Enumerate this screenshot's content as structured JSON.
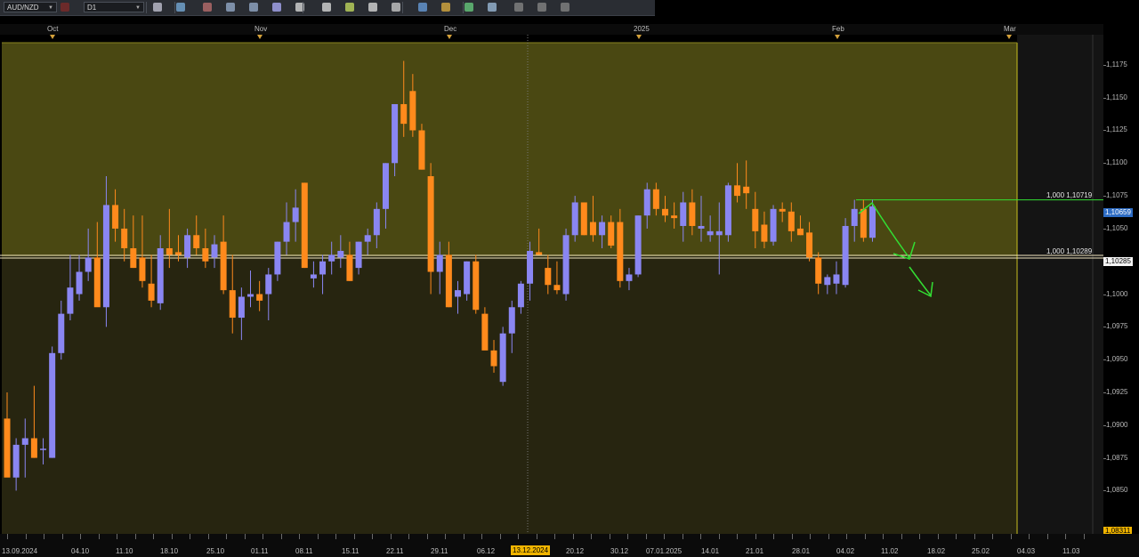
{
  "toolbar": {
    "symbol": "AUD/NZD",
    "timeframe": "D1",
    "icons": [
      "chart-type-icon",
      "indicators-icon",
      "zoom-in-icon",
      "zoom-out-icon",
      "crosshair-icon",
      "line-tool-icon",
      "text-tool-icon",
      "period-icon",
      "template-icon",
      "gear-icon",
      "pencil-icon",
      "trade-icon",
      "screenshot-icon",
      "pan-icon",
      "grid-icon",
      "settings-icon",
      "eraser-icon",
      "layout-icon"
    ]
  },
  "months": [
    {
      "label": "Oct"
    },
    {
      "label": "Nov"
    },
    {
      "label": "Dec"
    },
    {
      "label": "2025"
    },
    {
      "label": "Feb"
    },
    {
      "label": "Mar"
    }
  ],
  "x_labels": [
    "13.09.2024",
    "04.10",
    "11.10",
    "18.10",
    "25.10",
    "01.11",
    "08.11",
    "15.11",
    "22.11",
    "29.11",
    "06.12",
    "13.12.2024",
    "20.12",
    "30.12",
    "07.01.2025",
    "14.01",
    "21.01",
    "28.01",
    "04.02",
    "11.02",
    "18.02",
    "25.02",
    "04.03",
    "11.03"
  ],
  "current_date": "13.12.2024",
  "y_labels": [
    "1,1175",
    "1,1150",
    "1,1125",
    "1,1100",
    "1,1075",
    "1,1050",
    "1,1025",
    "1,1000",
    "1,0975",
    "1,0950",
    "1,0925",
    "1,0900",
    "1,0875",
    "1,0850"
  ],
  "price_box": "1,10659",
  "level_box": "1,10285",
  "bottom_box": "1,08311",
  "levels": [
    {
      "label": "1,000 1,10719",
      "price": 1.10719
    },
    {
      "label": "1,000 1,10289",
      "price": 1.10289
    }
  ],
  "colors": {
    "bull": "#8a86f2",
    "bear": "#ff8a1c",
    "upper_zone": "#4a4812",
    "lower_zone": "#272510",
    "future": "#141414",
    "annotation": "#33dd33"
  },
  "chart_data": {
    "type": "candlestick",
    "title": "AUD/NZD",
    "timeframe": "D1",
    "ylim": [
      1.0817,
      1.1198
    ],
    "candles": [
      {
        "o": 1.0905,
        "h": 1.0925,
        "l": 1.0865,
        "c": 1.086
      },
      {
        "o": 1.086,
        "h": 1.089,
        "l": 1.085,
        "c": 1.0885
      },
      {
        "o": 1.0885,
        "h": 1.0905,
        "l": 1.086,
        "c": 1.089
      },
      {
        "o": 1.089,
        "h": 1.093,
        "l": 1.0875,
        "c": 1.0875
      },
      {
        "o": 1.0882,
        "h": 1.089,
        "l": 1.087,
        "c": 1.0882
      },
      {
        "o": 1.0875,
        "h": 1.096,
        "l": 1.0875,
        "c": 1.0955
      },
      {
        "o": 1.0955,
        "h": 1.0995,
        "l": 1.095,
        "c": 1.0985
      },
      {
        "o": 1.0985,
        "h": 1.103,
        "l": 1.098,
        "c": 1.1005
      },
      {
        "o": 1.1,
        "h": 1.103,
        "l": 1.0995,
        "c": 1.1017
      },
      {
        "o": 1.1017,
        "h": 1.105,
        "l": 1.101,
        "c": 1.1028
      },
      {
        "o": 1.1028,
        "h": 1.1055,
        "l": 1.1,
        "c": 1.099
      },
      {
        "o": 1.099,
        "h": 1.109,
        "l": 1.0975,
        "c": 1.1068
      },
      {
        "o": 1.1068,
        "h": 1.108,
        "l": 1.104,
        "c": 1.105
      },
      {
        "o": 1.105,
        "h": 1.1065,
        "l": 1.1025,
        "c": 1.1035
      },
      {
        "o": 1.1035,
        "h": 1.106,
        "l": 1.102,
        "c": 1.102
      },
      {
        "o": 1.1028,
        "h": 1.106,
        "l": 1.1005,
        "c": 1.101
      },
      {
        "o": 1.1008,
        "h": 1.103,
        "l": 1.099,
        "c": 1.0995
      },
      {
        "o": 1.0993,
        "h": 1.1045,
        "l": 1.0988,
        "c": 1.1035
      },
      {
        "o": 1.1035,
        "h": 1.1065,
        "l": 1.102,
        "c": 1.103
      },
      {
        "o": 1.1032,
        "h": 1.1045,
        "l": 1.1025,
        "c": 1.103
      },
      {
        "o": 1.1028,
        "h": 1.105,
        "l": 1.102,
        "c": 1.1045
      },
      {
        "o": 1.1045,
        "h": 1.106,
        "l": 1.103,
        "c": 1.1035
      },
      {
        "o": 1.1035,
        "h": 1.105,
        "l": 1.102,
        "c": 1.1025
      },
      {
        "o": 1.1028,
        "h": 1.1045,
        "l": 1.102,
        "c": 1.1038
      },
      {
        "o": 1.104,
        "h": 1.106,
        "l": 1.1,
        "c": 1.1003
      },
      {
        "o": 1.1003,
        "h": 1.103,
        "l": 1.097,
        "c": 1.0982
      },
      {
        "o": 1.0982,
        "h": 1.1005,
        "l": 1.0965,
        "c": 1.0998
      },
      {
        "o": 1.0998,
        "h": 1.1018,
        "l": 1.099,
        "c": 1.1
      },
      {
        "o": 1.1,
        "h": 1.101,
        "l": 1.0987,
        "c": 1.0995
      },
      {
        "o": 1.1,
        "h": 1.102,
        "l": 1.098,
        "c": 1.1015
      },
      {
        "o": 1.1015,
        "h": 1.104,
        "l": 1.101,
        "c": 1.104
      },
      {
        "o": 1.104,
        "h": 1.107,
        "l": 1.103,
        "c": 1.1055
      },
      {
        "o": 1.1055,
        "h": 1.108,
        "l": 1.104,
        "c": 1.1066
      },
      {
        "o": 1.1085,
        "h": 1.1085,
        "l": 1.102,
        "c": 1.102
      },
      {
        "o": 1.1012,
        "h": 1.1025,
        "l": 1.1005,
        "c": 1.1015
      },
      {
        "o": 1.1015,
        "h": 1.103,
        "l": 1.1,
        "c": 1.1025
      },
      {
        "o": 1.1025,
        "h": 1.104,
        "l": 1.1015,
        "c": 1.103
      },
      {
        "o": 1.1028,
        "h": 1.1045,
        "l": 1.102,
        "c": 1.1033
      },
      {
        "o": 1.103,
        "h": 1.104,
        "l": 1.101,
        "c": 1.101
      },
      {
        "o": 1.102,
        "h": 1.104,
        "l": 1.1015,
        "c": 1.104
      },
      {
        "o": 1.104,
        "h": 1.105,
        "l": 1.103,
        "c": 1.1045
      },
      {
        "o": 1.1045,
        "h": 1.107,
        "l": 1.1035,
        "c": 1.1065
      },
      {
        "o": 1.1065,
        "h": 1.11,
        "l": 1.105,
        "c": 1.11
      },
      {
        "o": 1.11,
        "h": 1.114,
        "l": 1.109,
        "c": 1.1145
      },
      {
        "o": 1.1145,
        "h": 1.1178,
        "l": 1.112,
        "c": 1.113
      },
      {
        "o": 1.1155,
        "h": 1.1168,
        "l": 1.112,
        "c": 1.1125
      },
      {
        "o": 1.1125,
        "h": 1.113,
        "l": 1.1095,
        "c": 1.1095
      },
      {
        "o": 1.109,
        "h": 1.11,
        "l": 1.1,
        "c": 1.1017
      },
      {
        "o": 1.1017,
        "h": 1.104,
        "l": 1.1,
        "c": 1.103
      },
      {
        "o": 1.103,
        "h": 1.104,
        "l": 1.099,
        "c": 1.099
      },
      {
        "o": 1.0998,
        "h": 1.101,
        "l": 1.0985,
        "c": 1.1003
      },
      {
        "o": 1.1,
        "h": 1.1025,
        "l": 1.0995,
        "c": 1.1025
      },
      {
        "o": 1.1025,
        "h": 1.103,
        "l": 1.0985,
        "c": 1.0988
      },
      {
        "o": 1.0985,
        "h": 1.099,
        "l": 1.096,
        "c": 1.0957
      },
      {
        "o": 1.0957,
        "h": 1.0965,
        "l": 1.094,
        "c": 1.0945
      },
      {
        "o": 1.0933,
        "h": 1.0975,
        "l": 1.093,
        "c": 1.097
      },
      {
        "o": 1.097,
        "h": 1.0995,
        "l": 1.0955,
        "c": 1.099
      },
      {
        "o": 1.099,
        "h": 1.101,
        "l": 1.0985,
        "c": 1.1008
      },
      {
        "o": 1.1008,
        "h": 1.104,
        "l": 1.0995,
        "c": 1.1033
      },
      {
        "o": 1.1032,
        "h": 1.105,
        "l": 1.103,
        "c": 1.103
      },
      {
        "o": 1.102,
        "h": 1.103,
        "l": 1.1,
        "c": 1.1007
      },
      {
        "o": 1.1007,
        "h": 1.1025,
        "l": 1.1,
        "c": 1.1003
      },
      {
        "o": 1.1,
        "h": 1.105,
        "l": 1.0995,
        "c": 1.1045
      },
      {
        "o": 1.1045,
        "h": 1.1075,
        "l": 1.104,
        "c": 1.107
      },
      {
        "o": 1.107,
        "h": 1.107,
        "l": 1.1045,
        "c": 1.1045
      },
      {
        "o": 1.1055,
        "h": 1.1075,
        "l": 1.104,
        "c": 1.1045
      },
      {
        "o": 1.1045,
        "h": 1.106,
        "l": 1.1035,
        "c": 1.1055
      },
      {
        "o": 1.1055,
        "h": 1.106,
        "l": 1.1035,
        "c": 1.1037
      },
      {
        "o": 1.1055,
        "h": 1.1065,
        "l": 1.1005,
        "c": 1.101
      },
      {
        "o": 1.101,
        "h": 1.102,
        "l": 1.1003,
        "c": 1.1015
      },
      {
        "o": 1.1015,
        "h": 1.106,
        "l": 1.1013,
        "c": 1.106
      },
      {
        "o": 1.106,
        "h": 1.1085,
        "l": 1.105,
        "c": 1.108
      },
      {
        "o": 1.108,
        "h": 1.1085,
        "l": 1.106,
        "c": 1.1065
      },
      {
        "o": 1.1065,
        "h": 1.1075,
        "l": 1.1055,
        "c": 1.106
      },
      {
        "o": 1.106,
        "h": 1.107,
        "l": 1.105,
        "c": 1.1058
      },
      {
        "o": 1.1052,
        "h": 1.1078,
        "l": 1.104,
        "c": 1.107
      },
      {
        "o": 1.107,
        "h": 1.108,
        "l": 1.1045,
        "c": 1.1052
      },
      {
        "o": 1.105,
        "h": 1.1075,
        "l": 1.104,
        "c": 1.1052
      },
      {
        "o": 1.1045,
        "h": 1.106,
        "l": 1.104,
        "c": 1.1048
      },
      {
        "o": 1.1045,
        "h": 1.107,
        "l": 1.1015,
        "c": 1.1048
      },
      {
        "o": 1.1045,
        "h": 1.1085,
        "l": 1.104,
        "c": 1.1083
      },
      {
        "o": 1.1083,
        "h": 1.11,
        "l": 1.107,
        "c": 1.1075
      },
      {
        "o": 1.1082,
        "h": 1.1102,
        "l": 1.1065,
        "c": 1.1077
      },
      {
        "o": 1.1065,
        "h": 1.1078,
        "l": 1.1035,
        "c": 1.1048
      },
      {
        "o": 1.1053,
        "h": 1.1063,
        "l": 1.1035,
        "c": 1.104
      },
      {
        "o": 1.104,
        "h": 1.1068,
        "l": 1.1037,
        "c": 1.1065
      },
      {
        "o": 1.1065,
        "h": 1.107,
        "l": 1.1055,
        "c": 1.1063
      },
      {
        "o": 1.1063,
        "h": 1.107,
        "l": 1.104,
        "c": 1.1048
      },
      {
        "o": 1.105,
        "h": 1.106,
        "l": 1.1045,
        "c": 1.1045
      },
      {
        "o": 1.1047,
        "h": 1.1055,
        "l": 1.1025,
        "c": 1.1028
      },
      {
        "o": 1.1028,
        "h": 1.1032,
        "l": 1.1,
        "c": 1.1008
      },
      {
        "o": 1.1007,
        "h": 1.1015,
        "l": 1.1,
        "c": 1.1013
      },
      {
        "o": 1.1008,
        "h": 1.1025,
        "l": 1.1,
        "c": 1.1015
      },
      {
        "o": 1.1007,
        "h": 1.1058,
        "l": 1.1005,
        "c": 1.1052
      },
      {
        "o": 1.1052,
        "h": 1.1072,
        "l": 1.104,
        "c": 1.1065
      },
      {
        "o": 1.1065,
        "h": 1.1072,
        "l": 1.104,
        "c": 1.1043
      },
      {
        "o": 1.1043,
        "h": 1.1072,
        "l": 1.104,
        "c": 1.1067
      }
    ]
  }
}
